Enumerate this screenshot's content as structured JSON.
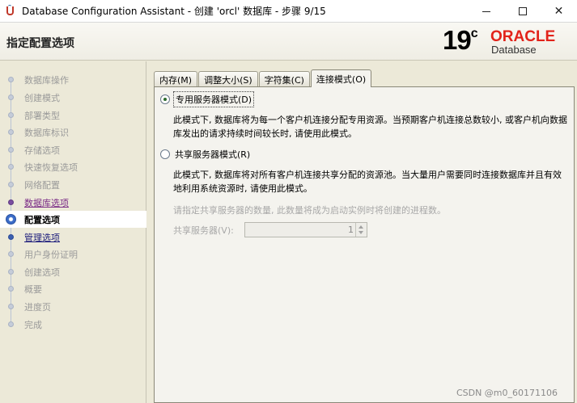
{
  "window": {
    "title": "Database Configuration Assistant - 创建 'orcl' 数据库 - 步骤 9/15"
  },
  "header": {
    "page_title": "指定配置选项",
    "logo_version": "19",
    "logo_version_sup": "c",
    "logo_brand": "ORACLE",
    "logo_product": "Database"
  },
  "nav": {
    "items": [
      {
        "label": "数据库操作",
        "state": "disabled"
      },
      {
        "label": "创建模式",
        "state": "disabled"
      },
      {
        "label": "部署类型",
        "state": "disabled"
      },
      {
        "label": "数据库标识",
        "state": "disabled"
      },
      {
        "label": "存储选项",
        "state": "disabled"
      },
      {
        "label": "快速恢复选项",
        "state": "disabled"
      },
      {
        "label": "网络配置",
        "state": "disabled"
      },
      {
        "label": "数据库选项",
        "state": "visited"
      },
      {
        "label": "配置选项",
        "state": "current"
      },
      {
        "label": "管理选项",
        "state": "link"
      },
      {
        "label": "用户身份证明",
        "state": "disabled"
      },
      {
        "label": "创建选项",
        "state": "disabled"
      },
      {
        "label": "概要",
        "state": "disabled"
      },
      {
        "label": "进度页",
        "state": "disabled"
      },
      {
        "label": "完成",
        "state": "disabled"
      }
    ]
  },
  "tabs": [
    {
      "label": "内存(M)",
      "active": false
    },
    {
      "label": "调整大小(S)",
      "active": false
    },
    {
      "label": "字符集(C)",
      "active": false
    },
    {
      "label": "连接模式(O)",
      "active": true
    }
  ],
  "connection_mode": {
    "dedicated": {
      "label": "专用服务器模式(D)",
      "checked": true,
      "description": "此模式下, 数据库将为每一个客户机连接分配专用资源。当预期客户机连接总数较小, 或客户机向数据库发出的请求持续时间较长时, 请使用此模式。"
    },
    "shared": {
      "label": "共享服务器模式(R)",
      "checked": false,
      "description": "此模式下, 数据库将对所有客户机连接共享分配的资源池。当大量用户需要同时连接数据库并且有效地利用系统资源时, 请使用此模式。",
      "hint": "请指定共享服务器的数量, 此数量将成为启动实例时将创建的进程数。",
      "field_label": "共享服务器(V):",
      "field_value": "1"
    }
  },
  "watermark": "CSDN @m0_60171106"
}
